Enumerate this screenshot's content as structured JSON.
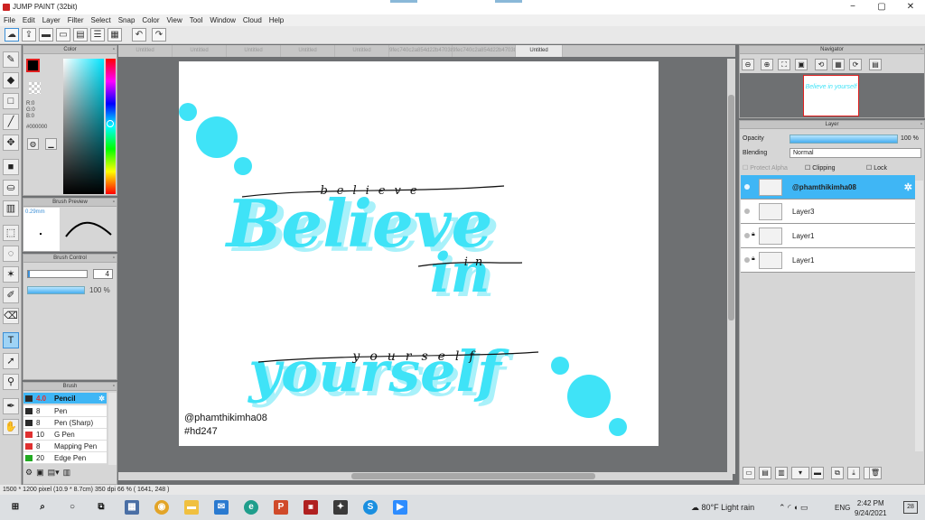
{
  "app": {
    "title": "JUMP PAINT (32bit)"
  },
  "window_controls": [
    "−",
    "▢",
    "✕"
  ],
  "menu": [
    "File",
    "Edit",
    "Layer",
    "Filter",
    "Select",
    "Snap",
    "Color",
    "View",
    "Tool",
    "Window",
    "Cloud",
    "Help"
  ],
  "color_panel": {
    "title": "Color",
    "r": "R:0",
    "g": "G:0",
    "b": "B:0",
    "hex": "#000000"
  },
  "brush_preview": {
    "title": "Brush Preview",
    "size": "0.29mm"
  },
  "brush_control": {
    "title": "Brush Control",
    "size": "4",
    "opacity": "100 %"
  },
  "brush_panel": {
    "title": "Brush",
    "items": [
      {
        "size": "4.0",
        "name": "Pencil",
        "color": "#2a2a2a",
        "selected": true
      },
      {
        "size": "8",
        "name": "Pen",
        "color": "#2a2a2a"
      },
      {
        "size": "8",
        "name": "Pen (Sharp)",
        "color": "#2a2a2a"
      },
      {
        "size": "10",
        "name": "G Pen",
        "color": "#e03030"
      },
      {
        "size": "8",
        "name": "Mapping Pen",
        "color": "#e03030"
      },
      {
        "size": "20",
        "name": "Edge Pen",
        "color": "#22aa22"
      }
    ]
  },
  "tabs": [
    "Untitled",
    "Untitled",
    "Untitled",
    "Untitled",
    "Untitled",
    "9fec740c2a854d22b47038e788faa0e1.jpg",
    "9fec740c2a854d22b47038e788faa0e1.jpg",
    "Untitled"
  ],
  "artwork": {
    "word1": "Believe",
    "word2": "in",
    "word3": "yourself",
    "hand1": "believe",
    "hand2": "in",
    "hand3": "yourself",
    "credit": "@phamthikimha08",
    "hashtag": "#hd247",
    "accent": "#3fe3f7"
  },
  "navigator": {
    "title": "Navigator",
    "thumb_text": "Believe in yourself"
  },
  "layer_panel": {
    "title": "Layer",
    "opacity_label": "Opacity",
    "opacity_value": "100 %",
    "blending_label": "Blending",
    "blending_value": "Normal",
    "protect_alpha": "Protect Alpha",
    "clipping": "Clipping",
    "lock": "Lock",
    "layers": [
      {
        "name": "@phamthikimha08",
        "selected": true
      },
      {
        "name": "Layer3"
      },
      {
        "name": "Layer1"
      },
      {
        "name": "Layer1"
      }
    ]
  },
  "status": "1500 * 1200 pixel  (10.9 * 8.7cm)  350 dpi  66 %  ( 1641, 248 )",
  "taskbar": {
    "weather": "80°F  Light rain",
    "lang": "ENG",
    "time": "2:42 PM",
    "date": "9/24/2021",
    "notif": "28"
  }
}
